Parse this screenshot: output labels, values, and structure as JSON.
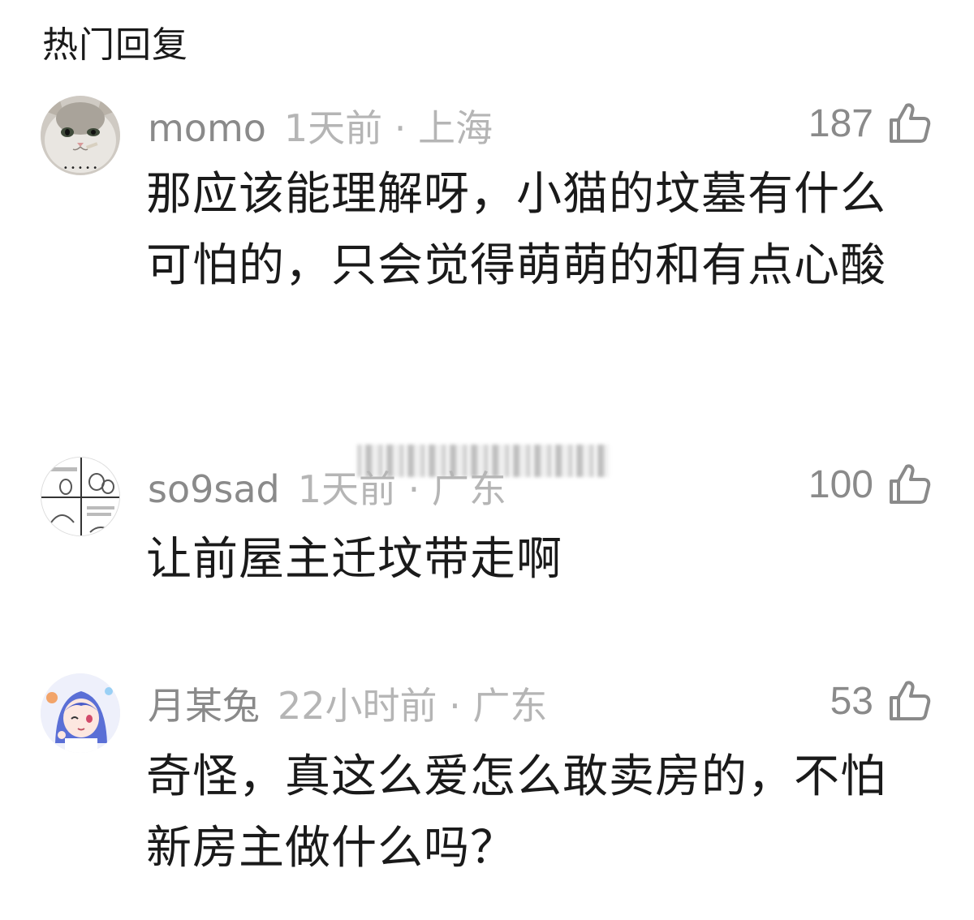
{
  "header": {
    "title": "热门回复"
  },
  "comments": [
    {
      "avatar_icon": "cat-avatar-icon",
      "username": "momo",
      "time_location": "1天前 · 上海",
      "likes": "187",
      "content": "那应该能理解呀，小猫的坟墓有什么可怕的，只会觉得萌萌的和有点心酸"
    },
    {
      "avatar_icon": "comic-avatar-icon",
      "username": "so9sad",
      "time_location": "1天前 · 广东",
      "likes": "100",
      "content": "让前屋主迁坟带走啊"
    },
    {
      "avatar_icon": "anime-girl-avatar-icon",
      "username": "月某兔",
      "time_location": "22小时前 · 广东",
      "likes": "53",
      "content": "奇怪，真这么爱怎么敢卖房的，不怕新房主做什么吗？"
    }
  ],
  "colors": {
    "primary_text": "#1a1a1a",
    "username": "#8a8a8a",
    "meta": "#b5b5b5",
    "like": "#8a8a8a"
  }
}
